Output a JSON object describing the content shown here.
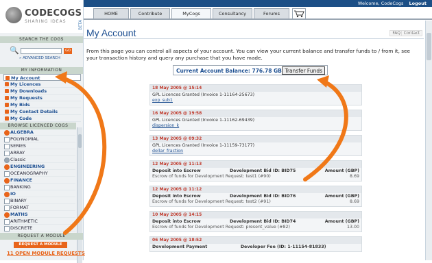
{
  "topbar": {
    "welcome": "Welcome, CodeCogs",
    "logout": "Logout"
  },
  "logo": {
    "name": "CODECOGS",
    "tagline": "SHARING IDEAS",
    "beta": "BETA"
  },
  "tabs": [
    "HOME",
    "Contribute",
    "MyCogs",
    "Consultancy",
    "Forums"
  ],
  "sidebar": {
    "search_heading": "SEARCH THE COGS",
    "go_label": "GO",
    "advanced_search": "» ADVANCED SEARCH",
    "info_heading": "MY INFORMATION",
    "info_items": [
      "My Account",
      "My Licences",
      "My Downloads",
      "My Requests",
      "My Bids",
      "My Contact Details",
      "My Code"
    ],
    "browse_heading": "BROWSE LICENCED COGS",
    "cogs": [
      {
        "label": "ALGEBRA",
        "type": "orange"
      },
      {
        "label": "POLYNOMIAL",
        "type": "plain"
      },
      {
        "label": "SERIES",
        "type": "plain"
      },
      {
        "label": "ARRAY",
        "type": "plain"
      },
      {
        "label": "Classic",
        "type": "classic"
      },
      {
        "label": "ENGINEERING",
        "type": "orange"
      },
      {
        "label": "OCEANOGRAPHY",
        "type": "plain"
      },
      {
        "label": "FINANCE",
        "type": "orange"
      },
      {
        "label": "BANKING",
        "type": "plain"
      },
      {
        "label": "IO",
        "type": "orange"
      },
      {
        "label": "BINARY",
        "type": "plain"
      },
      {
        "label": "FORMAT",
        "type": "plain"
      },
      {
        "label": "MATHS",
        "type": "orange"
      },
      {
        "label": "ARITHMETIC",
        "type": "plain"
      },
      {
        "label": "DISCRETE",
        "type": "plain"
      }
    ],
    "request_heading": "REQUEST A MODULE",
    "request_button": "REQUEST A MODULE",
    "open_requests": "11 OPEN MODULE REQUESTS"
  },
  "main": {
    "title": "My Account",
    "faq": "FAQ",
    "contact": "Contact",
    "intro": "From this page you can control all aspects of your account. You can view your current balance and transfer funds to / from it, see your transaction history and query any purchase that you have made.",
    "balance_label": "Current Account Balance: 776.78 GBP",
    "transfer_button": "Transfer Funds"
  },
  "transactions": [
    {
      "date": "18 May 2005 @ 15:14",
      "title": "GPL Licences Granted (Invoice 1-11164-25673)",
      "link": "exp_sub1"
    },
    {
      "date": "16 May 2005 @ 19:58",
      "title": "GPL Licences Granted (Invoice 1-11162-69439)",
      "link": "dispersion_k"
    },
    {
      "date": "13 May 2005 @ 09:32",
      "title": "GPL Licences Granted (Invoice 1-11159-73177)",
      "link": "dollar_fraction"
    },
    {
      "date": "12 May 2005 @ 11:13",
      "title": "Deposit into Escrow",
      "bid": "Development Bid ID: BID75",
      "amount_label": "Amount (GBP)",
      "amount": "8.69",
      "note": "Escrow of funds for Development Request: test1 (#90)"
    },
    {
      "date": "12 May 2005 @ 11:12",
      "title": "Deposit into Escrow",
      "bid": "Development Bid ID: BID76",
      "amount_label": "Amount (GBP)",
      "amount": "8.69",
      "note": "Escrow of funds for Development Request: test2 (#91)"
    },
    {
      "date": "10 May 2005 @ 14:15",
      "title": "Deposit into Escrow",
      "bid": "Development Bid ID: BID74",
      "amount_label": "Amount (GBP)",
      "amount": "13.00",
      "note": "Escrow of funds for Development Request: present_value (#82)"
    },
    {
      "date": "06 May 2005 @ 18:52",
      "title": "Development Payment",
      "bid": "Developer Fee (ID: 1-11154-81833)",
      "amount_label": "",
      "amount": "",
      "note": ""
    }
  ],
  "colors": {
    "accent": "#e8641a",
    "brand": "#1d4f91",
    "topbar": "#1c4f86"
  }
}
